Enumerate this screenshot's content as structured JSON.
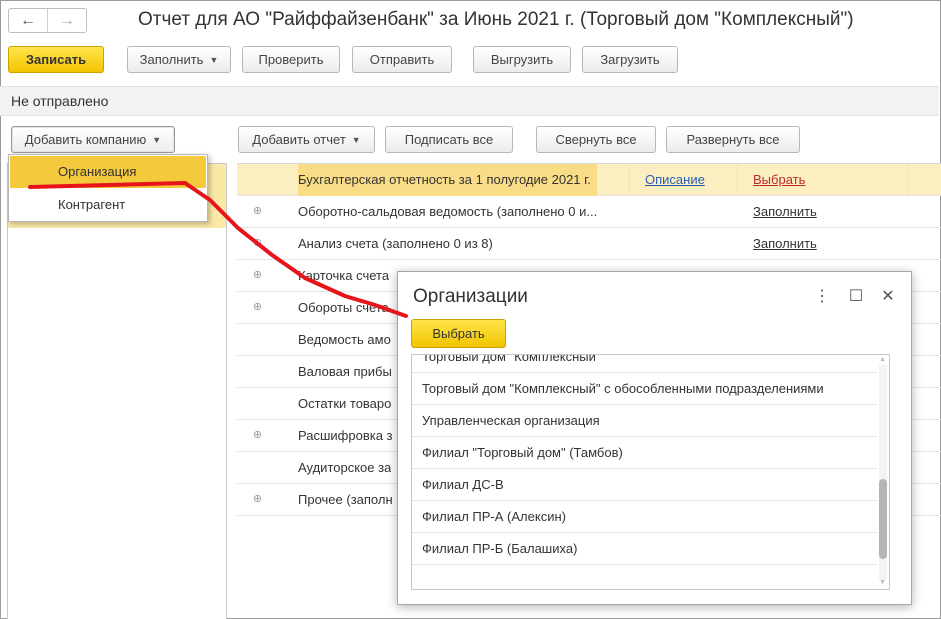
{
  "nav": {
    "back_icon": "←",
    "forward_icon": "→"
  },
  "title": "Отчет для АО \"Райффайзенбанк\" за Июнь 2021 г. (Торговый дом \"Комплексный\")",
  "toolbar": {
    "save": "Записать",
    "fill": "Заполнить",
    "check": "Проверить",
    "send": "Отправить",
    "export": "Выгрузить",
    "import": "Загрузить"
  },
  "status": "Не отправлено",
  "subtoolbar": {
    "add_company": "Добавить компанию",
    "add_report": "Добавить отчет",
    "sign_all": "Подписать все",
    "collapse_all": "Свернуть все",
    "expand_all": "Развернуть все"
  },
  "company_menu": {
    "items": [
      "Организация",
      "Контрагент"
    ],
    "selected": "Организация"
  },
  "left_panel": {
    "hidden_text_tail": "\""
  },
  "reports": [
    {
      "name": "Бухгалтерская отчетность за 1 полугодие 2021 г.",
      "desc": "Описание",
      "action": "Выбрать",
      "expandable": false,
      "selected": true
    },
    {
      "name": "Оборотно-сальдовая ведомость (заполнено 0 и...",
      "action": "Заполнить",
      "expandable": true
    },
    {
      "name": "Анализ счета (заполнено 0 из 8)",
      "action": "Заполнить",
      "expandable": true
    },
    {
      "name": "Карточка счета",
      "action": "",
      "expandable": true
    },
    {
      "name": "Обороты счета",
      "action": "",
      "expandable": true
    },
    {
      "name": "Ведомость амо",
      "action": "",
      "expandable": false
    },
    {
      "name": "Валовая прибы",
      "action": "",
      "expandable": false
    },
    {
      "name": "Остатки товаро",
      "action": "",
      "expandable": false
    },
    {
      "name": "Расшифровка з",
      "action": "",
      "expandable": true
    },
    {
      "name": "Аудиторское за",
      "action": "",
      "expandable": false
    },
    {
      "name": "Прочее (заполн",
      "action": "",
      "expandable": true
    }
  ],
  "modal": {
    "title": "Организации",
    "choose_button": "Выбрать",
    "more_icon": "⋮",
    "maximize_icon": "☐",
    "close_icon": "✕",
    "organizations": [
      "Торговый дом \"Комплексный\"",
      "Торговый дом \"Комплексный\" с обособленными подразделениями",
      "Управленческая организация",
      "Филиал \"Торговый дом\" (Тамбов)",
      "Филиал ДС-В",
      "Филиал ПР-А (Алексин)",
      "Филиал ПР-Б (Балашиха)"
    ]
  },
  "colors": {
    "accent_yellow": "#f4c93c",
    "selection": "#fbefc2",
    "link_blue": "#2a5db0",
    "link_red": "#c0282a",
    "annotation_red": "#e8141b"
  }
}
